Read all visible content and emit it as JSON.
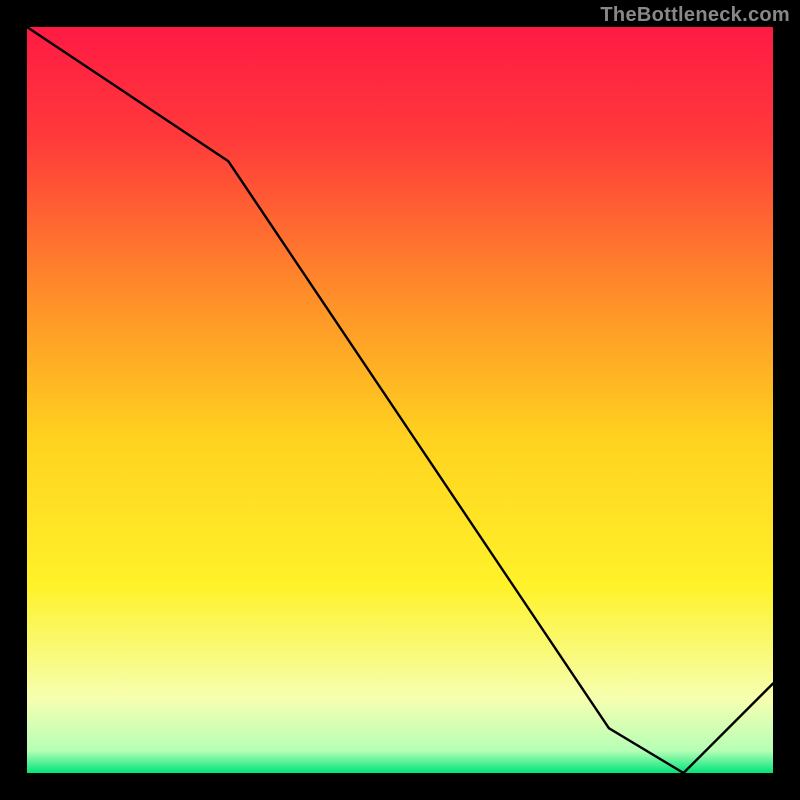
{
  "attribution": "TheBottleneck.com",
  "chart_data": {
    "type": "line",
    "title": "",
    "xlabel": "",
    "ylabel": "",
    "xlim": [
      0,
      100
    ],
    "ylim": [
      0,
      100
    ],
    "x": [
      0,
      27,
      78,
      88,
      100
    ],
    "values": [
      100,
      82,
      6,
      0,
      12
    ],
    "minimum_label": "",
    "minimum_x": 82,
    "background_gradient": {
      "stops": [
        {
          "pos": 0.0,
          "color": "#ff1a44"
        },
        {
          "pos": 0.15,
          "color": "#ff3a3a"
        },
        {
          "pos": 0.35,
          "color": "#ff8a2a"
        },
        {
          "pos": 0.55,
          "color": "#ffd21f"
        },
        {
          "pos": 0.75,
          "color": "#fff22a"
        },
        {
          "pos": 0.9,
          "color": "#f6ffb0"
        },
        {
          "pos": 0.97,
          "color": "#b6ffb6"
        },
        {
          "pos": 1.0,
          "color": "#00e47a"
        }
      ]
    }
  },
  "colors": {
    "line": "#000000",
    "border": "#000000",
    "min_label": "#e40000"
  }
}
